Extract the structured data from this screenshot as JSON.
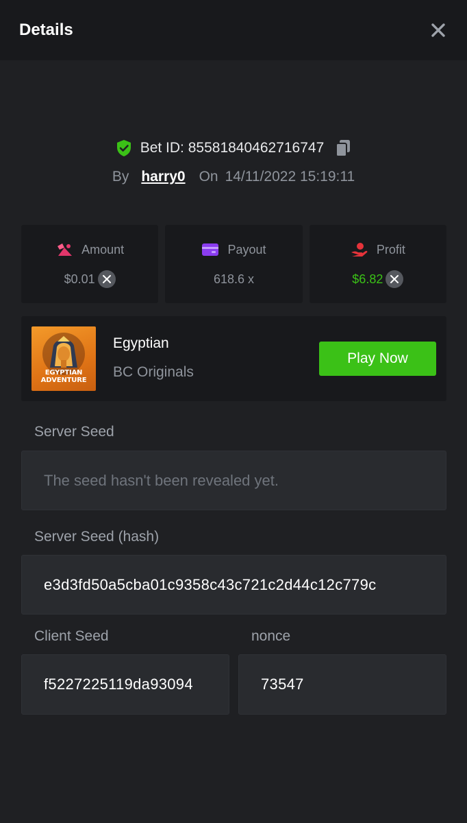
{
  "header": {
    "title": "Details"
  },
  "bet": {
    "id_label": "Bet ID: 85581840462716747",
    "by_label": "By",
    "username": "harry0",
    "on_label": "On",
    "datetime": "14/11/2022 15:19:11"
  },
  "stats": {
    "amount": {
      "label": "Amount",
      "value": "$0.01"
    },
    "payout": {
      "label": "Payout",
      "value": "618.6 x"
    },
    "profit": {
      "label": "Profit",
      "value": "$6.82"
    }
  },
  "game": {
    "thumb_text": "EGYPTIAN ADVENTURE",
    "name": "Egyptian",
    "provider": "BC Originals",
    "play_label": "Play Now"
  },
  "seeds": {
    "server_seed_label": "Server Seed",
    "server_seed_value": "The seed hasn't been revealed yet.",
    "server_hash_label": "Server Seed (hash)",
    "server_hash_value": "e3d3fd50a5cba01c9358c43c721c2d44c12c779c",
    "client_seed_label": "Client Seed",
    "client_seed_value": "f5227225119da93094",
    "nonce_label": "nonce",
    "nonce_value": "73547"
  },
  "colors": {
    "background": "#1f2023",
    "panel": "#18191c",
    "accent_green": "#3bc117",
    "muted_text": "#8f949c"
  }
}
